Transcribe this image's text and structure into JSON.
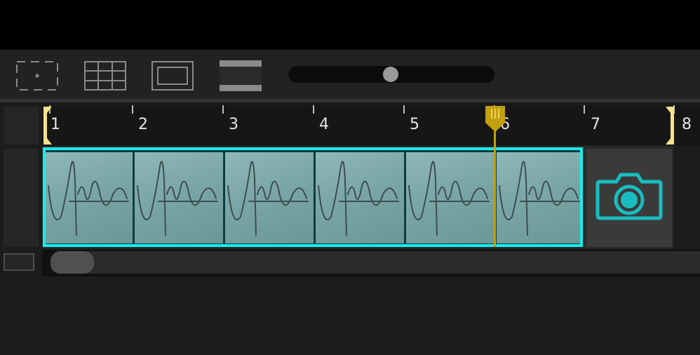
{
  "toolbar": {
    "tools": [
      {
        "icon": "crop-target-icon"
      },
      {
        "icon": "grid-icon"
      },
      {
        "icon": "frame-icon"
      },
      {
        "icon": "letterbox-icon"
      }
    ],
    "zoom_level": 0.5
  },
  "ruler": {
    "ticks": [
      "1",
      "2",
      "3",
      "4",
      "5",
      "6",
      "7",
      "8"
    ]
  },
  "timeline": {
    "clip_frame_count": 6,
    "playhead_position": 6.0,
    "in_point": 1,
    "out_point": 8,
    "camera_icon": "camera-icon"
  },
  "colors": {
    "clip_border": "#19ecec",
    "playhead": "#c2a00e",
    "marker": "#f4e28c",
    "camera": "#19bcc0"
  }
}
